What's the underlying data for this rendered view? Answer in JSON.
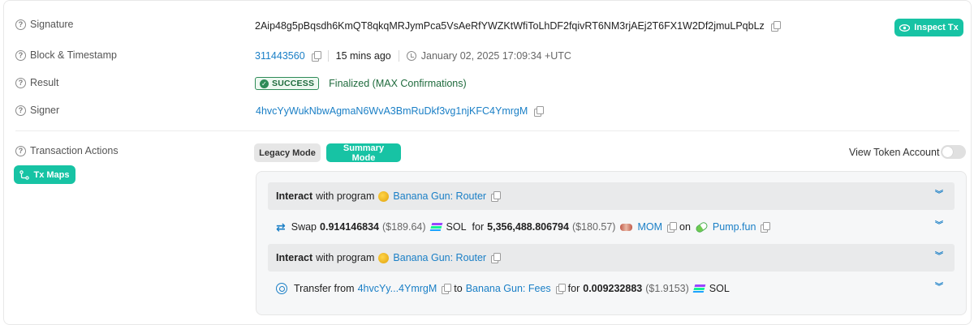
{
  "signature": {
    "label": "Signature",
    "value": "2Aip48g5pBqsdh6KmQT8qkqMRJymPca5VsAeRfYWZKtWfiToLhDF2fqivRT6NM3rjAEj2T6FX1W2Df2jmuLPqbLz",
    "inspect_label": "Inspect Tx"
  },
  "block": {
    "label": "Block & Timestamp",
    "number": "311443560",
    "ago": "15 mins ago",
    "timestamp": "January 02, 2025 17:09:34 +UTC"
  },
  "result": {
    "label": "Result",
    "status": "SUCCESS",
    "finality": "Finalized (MAX Confirmations)"
  },
  "signer": {
    "label": "Signer",
    "value": "4hvcYyWukNbwAgmaN6WvA3BmRuDkf3vg1njKFC4YmrgM"
  },
  "actions": {
    "label": "Transaction Actions",
    "tx_maps_label": "Tx Maps",
    "legacy_mode_label": "Legacy Mode",
    "summary_mode_label": "Summary Mode",
    "view_token_account_label": "View Token Account",
    "view_token_account_on": false,
    "rows": [
      {
        "type": "interact",
        "prefix": "Interact",
        "middle": "with program",
        "program": "Banana Gun: Router"
      },
      {
        "type": "swap",
        "verb": "Swap",
        "amount_in": "0.914146834",
        "usd_in": "($189.64)",
        "token_in": "SOL",
        "for_word": "for",
        "amount_out": "5,356,488.806794",
        "usd_out": "($180.57)",
        "token_out": "MOM",
        "on_word": "on",
        "venue": "Pump.fun"
      },
      {
        "type": "interact",
        "prefix": "Interact",
        "middle": "with program",
        "program": "Banana Gun: Router"
      },
      {
        "type": "transfer",
        "verb": "Transfer from",
        "from": "4hvcYy...4YmrgM",
        "to_word": "to",
        "to": "Banana Gun: Fees",
        "for_word": "for",
        "amount": "0.009232883",
        "usd": "($1.9153)",
        "token": "SOL"
      }
    ]
  },
  "icons": {
    "help": "question-circle-icon",
    "copy": "copy-icon",
    "clock": "clock-icon",
    "eye": "eye-icon",
    "chevron": "double-chevron-down-icon"
  },
  "colors": {
    "accent": "#17c3a4",
    "link": "#1a7fc6",
    "success": "#2e8b57"
  }
}
